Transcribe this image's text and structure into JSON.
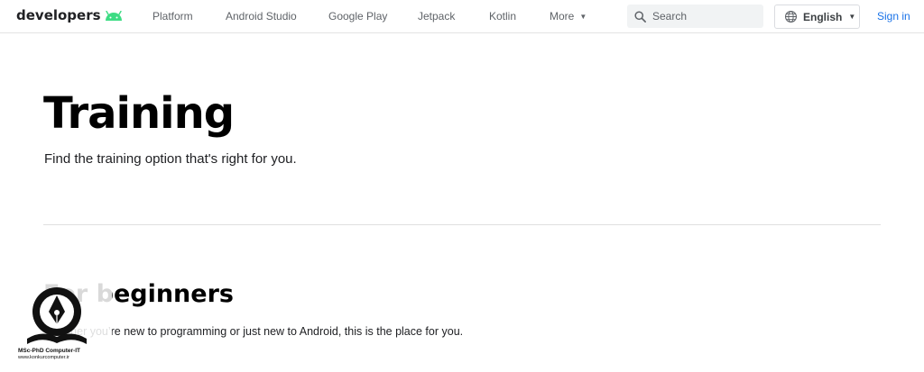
{
  "header": {
    "brand": "developers",
    "nav": [
      {
        "label": "Platform"
      },
      {
        "label": "Android Studio"
      },
      {
        "label": "Google Play"
      },
      {
        "label": "Jetpack"
      },
      {
        "label": "Kotlin"
      },
      {
        "label": "More"
      }
    ],
    "search": {
      "placeholder": "Search"
    },
    "language": "English",
    "signin": "Sign in"
  },
  "hero": {
    "title": "Training",
    "subtitle": "Find the training option that's right for you."
  },
  "section": {
    "title": "For beginners",
    "subtitle": "Whether you’re new to programming or just new to Android, this is the place for you."
  },
  "watermark": {
    "line1": "MSc-PhD Computer-IT",
    "line2": "www.konkurcomputer.ir"
  },
  "colors": {
    "accent": "#1a73e8",
    "android_green": "#3ddc84"
  },
  "icons": [
    "android-logo-icon",
    "chevron-down-icon",
    "search-icon",
    "globe-icon",
    "book-pen-logo-icon"
  ]
}
